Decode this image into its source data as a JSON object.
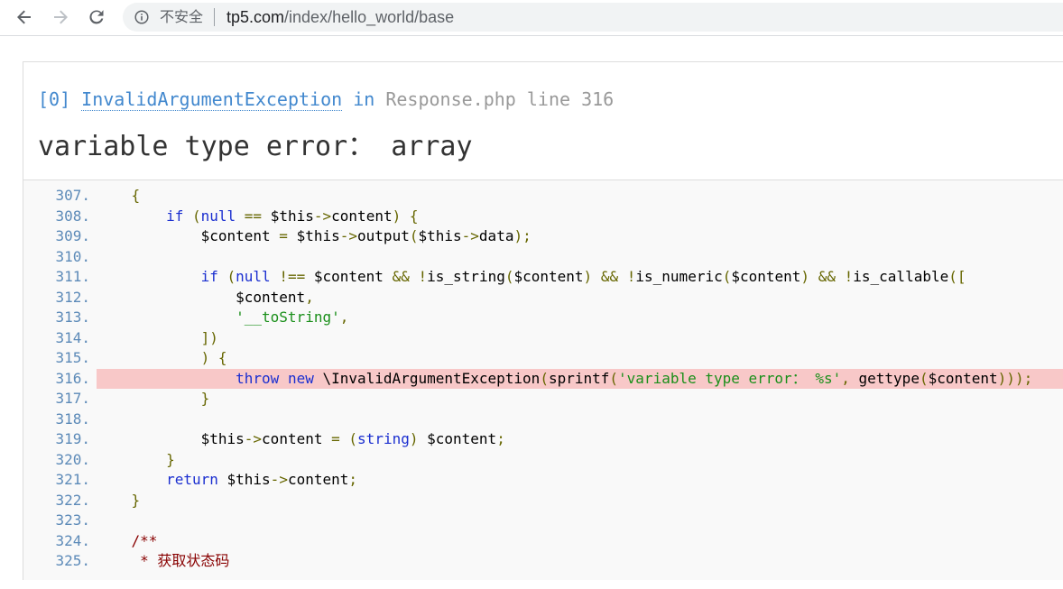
{
  "browser": {
    "security_label": "不安全",
    "url_host": "tp5.com",
    "url_path": "/index/hello_world/base",
    "back_icon": "arrow-left-icon",
    "forward_icon": "arrow-right-icon",
    "reload_icon": "reload-icon",
    "info_icon": "info-circle-icon"
  },
  "exception": {
    "index": "[0]",
    "class_name": "InvalidArgumentException",
    "in_word": "in",
    "file": "Response.php",
    "line_label": "line 316",
    "message": "variable type error： array"
  },
  "source": {
    "highlight_line": 316,
    "lines": [
      {
        "no": "307.",
        "code": "    {"
      },
      {
        "no": "308.",
        "code": "        if (null == $this->content) {"
      },
      {
        "no": "309.",
        "code": "            $content = $this->output($this->data);"
      },
      {
        "no": "310.",
        "code": ""
      },
      {
        "no": "311.",
        "code": "            if (null !== $content && !is_string($content) && !is_numeric($content) && !is_callable(["
      },
      {
        "no": "312.",
        "code": "                $content,"
      },
      {
        "no": "313.",
        "code": "                '__toString',"
      },
      {
        "no": "314.",
        "code": "            ])"
      },
      {
        "no": "315.",
        "code": "            ) {"
      },
      {
        "no": "316.",
        "code": "                throw new \\InvalidArgumentException(sprintf('variable type error： %s', gettype($content)));"
      },
      {
        "no": "317.",
        "code": "            }"
      },
      {
        "no": "318.",
        "code": ""
      },
      {
        "no": "319.",
        "code": "            $this->content = (string) $content;"
      },
      {
        "no": "320.",
        "code": "        }"
      },
      {
        "no": "321.",
        "code": "        return $this->content;"
      },
      {
        "no": "322.",
        "code": "    }"
      },
      {
        "no": "323.",
        "code": ""
      },
      {
        "no": "324.",
        "code": "    /**"
      },
      {
        "no": "325.",
        "code": "     * 获取状态码"
      }
    ]
  }
}
